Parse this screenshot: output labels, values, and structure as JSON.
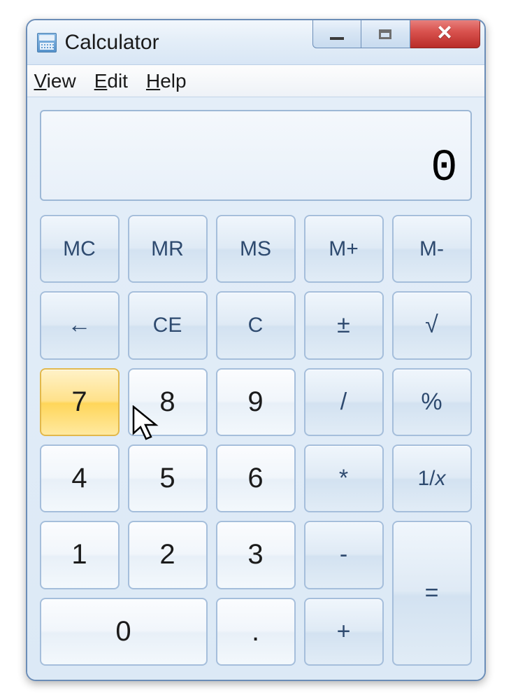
{
  "window": {
    "title": "Calculator"
  },
  "menu": {
    "view": "View",
    "edit": "Edit",
    "help": "Help"
  },
  "display": {
    "value": "0"
  },
  "buttons": {
    "mc": "MC",
    "mr": "MR",
    "ms": "MS",
    "mplus": "M+",
    "mminus": "M-",
    "backspace": "←",
    "ce": "CE",
    "c": "C",
    "negate": "±",
    "sqrt": "√",
    "d7": "7",
    "d8": "8",
    "d9": "9",
    "divide": "/",
    "percent": "%",
    "d4": "4",
    "d5": "5",
    "d6": "6",
    "multiply": "*",
    "reciprocal": "1/x",
    "d1": "1",
    "d2": "2",
    "d3": "3",
    "subtract": "-",
    "equals": "=",
    "d0": "0",
    "decimal": ".",
    "add": "+"
  }
}
